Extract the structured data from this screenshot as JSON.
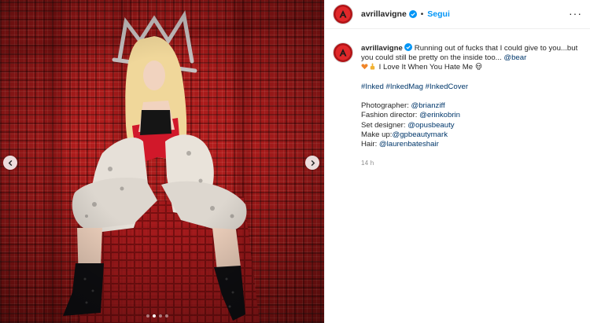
{
  "post": {
    "media": {
      "prev_icon": "chevron-left-icon",
      "next_icon": "chevron-right-icon",
      "carousel_dots": 4,
      "active_dot": 1
    },
    "header": {
      "username": "avrillavigne",
      "separator": "•",
      "follow_label": "Segui",
      "more_label": "···"
    },
    "caption": {
      "username": "avrillavigne",
      "text": "Running out of fucks that I could give to you...but you could still be pretty on the inside too... ",
      "mention": "@bear",
      "line2": "I Love It When You Hate Me",
      "hashtags": [
        "#Inked",
        "#InkedMag",
        "#InkedCover"
      ],
      "credits": [
        {
          "label": "Photographer: ",
          "handle": "@brianziff"
        },
        {
          "label": "Fashion director: ",
          "handle": "@erinkobrin"
        },
        {
          "label": "Set designer: ",
          "handle": "@opusbeauty"
        },
        {
          "label": "Make up:",
          "handle": "@gpbeautymark"
        },
        {
          "label": "Hair: ",
          "handle": "@laurenbateshair"
        }
      ],
      "timestamp": "14 h"
    },
    "colors": {
      "accent": "#0095f6",
      "link": "#00376b",
      "muted": "#8e8e8e",
      "border": "#efefef",
      "backdrop_red": "#b21d1d"
    }
  }
}
